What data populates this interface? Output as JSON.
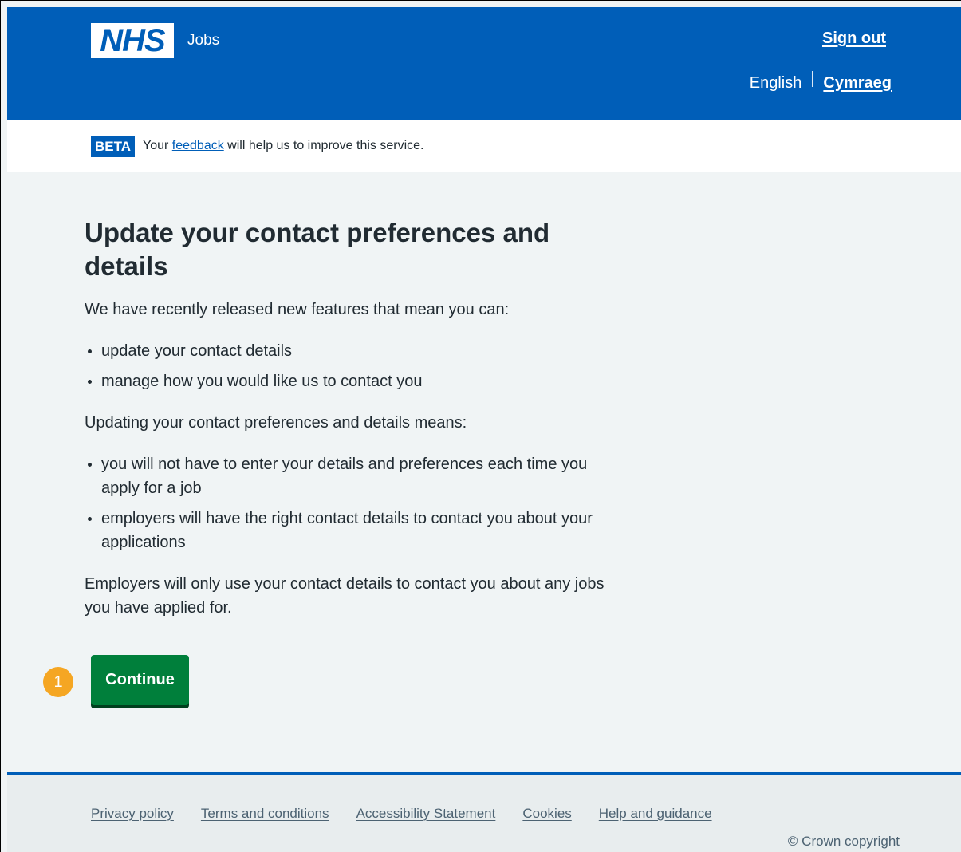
{
  "header": {
    "logo_text": "NHS",
    "service_name": "Jobs",
    "sign_out": "Sign out",
    "languages": {
      "current": "English",
      "alternate": "Cymraeg"
    }
  },
  "beta_banner": {
    "tag": "BETA",
    "text_before": "Your",
    "link": "feedback",
    "text_after": "will help us to improve this service."
  },
  "main": {
    "title": "Update your contact preferences and details",
    "intro": "We have recently released new features that mean you can:",
    "features": [
      "update your contact details",
      "manage how you would like us to contact you"
    ],
    "benefits_intro": "Updating your contact preferences and details means:",
    "benefits": [
      "you will not have to enter your details and preferences each time you apply for a job",
      "employers will have the right contact details to contact you about your applications"
    ],
    "note": "Employers will only use your contact details to contact you about any jobs you have applied for.",
    "continue_button": "Continue",
    "step_marker": "1"
  },
  "footer": {
    "links": [
      "Privacy policy",
      "Terms and conditions",
      "Accessibility Statement",
      "Cookies",
      "Help and guidance"
    ],
    "copyright": "© Crown copyright"
  },
  "colors": {
    "nhs_blue": "#005eb8",
    "button_green": "#007f3b",
    "marker_orange": "#f5a623",
    "page_bg": "#f0f4f5"
  }
}
